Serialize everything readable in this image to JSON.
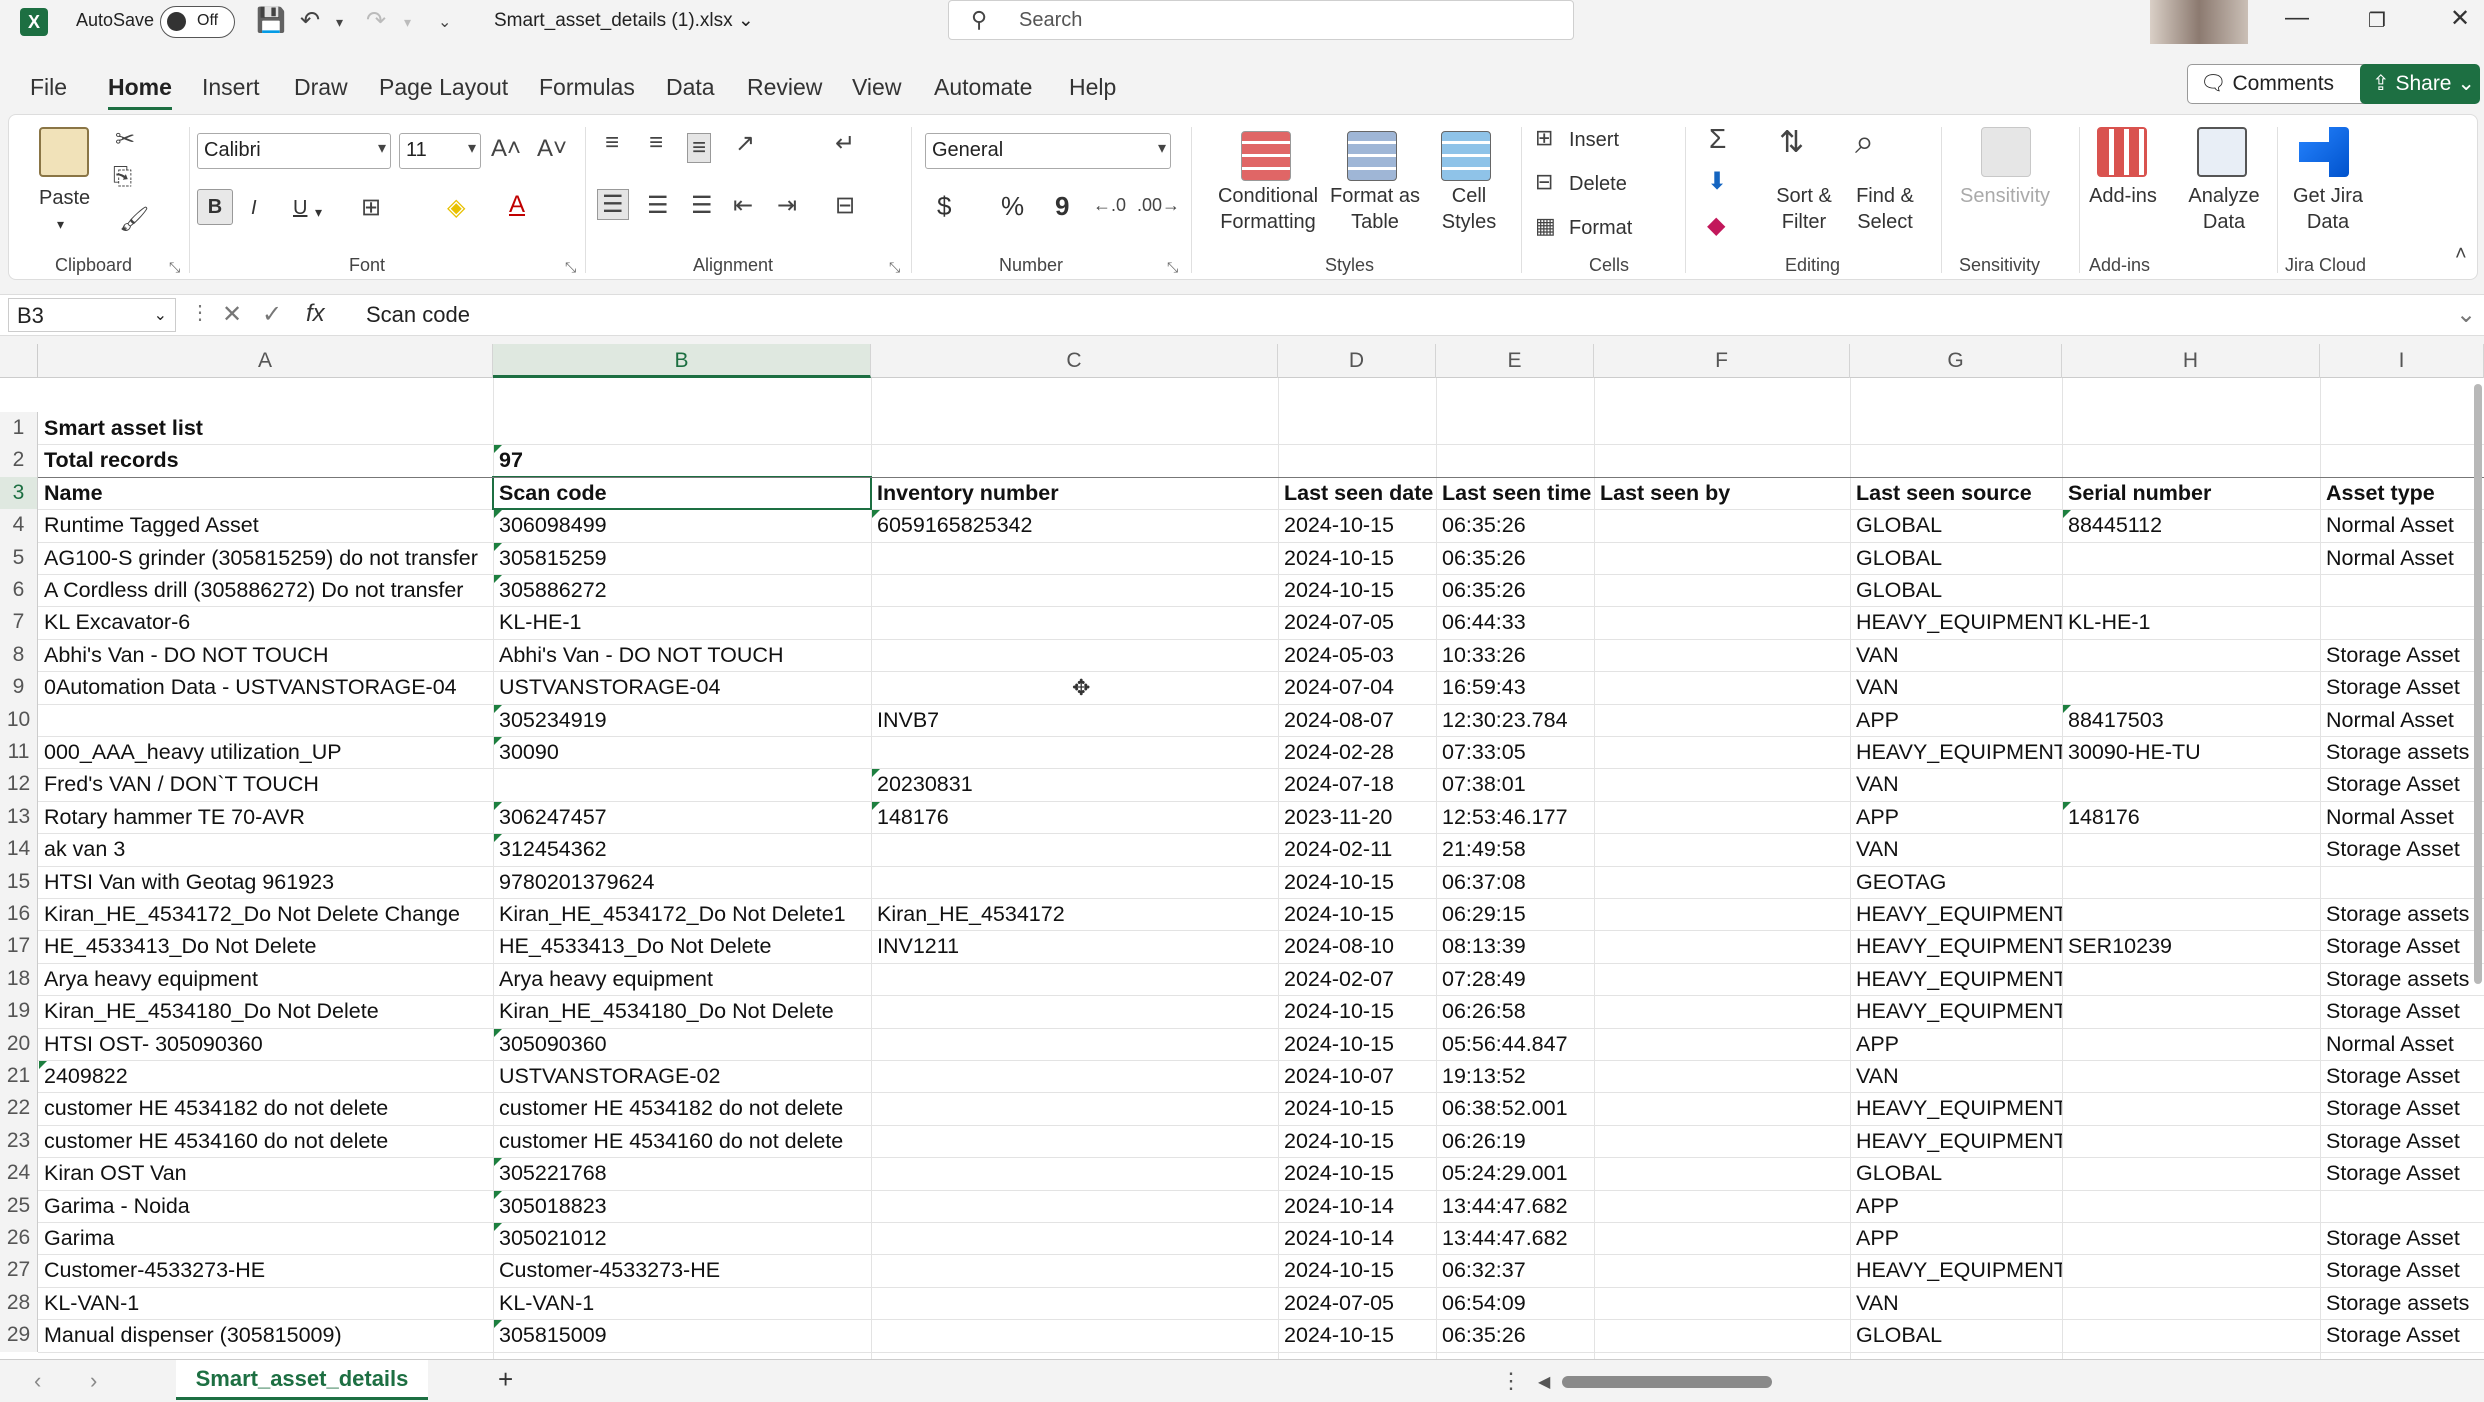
{
  "titlebar": {
    "autosave_label": "AutoSave",
    "autosave_state": "Off",
    "file_name": "Smart_asset_details (1).xlsx",
    "search_placeholder": "Search"
  },
  "menu_tabs": [
    "File",
    "Home",
    "Insert",
    "Draw",
    "Page Layout",
    "Formulas",
    "Data",
    "Review",
    "View",
    "Automate",
    "Help"
  ],
  "active_tab": "Home",
  "header_buttons": {
    "comments": "Comments",
    "share": "Share"
  },
  "ribbon": {
    "clipboard": {
      "paste": "Paste",
      "group": "Clipboard"
    },
    "font": {
      "name": "Calibri",
      "size": "11",
      "group": "Font",
      "bold": "B",
      "italic": "I",
      "underline": "U"
    },
    "alignment": {
      "group": "Alignment"
    },
    "number": {
      "format": "General",
      "group": "Number",
      "currency": "$",
      "percent": "%",
      "comma": "9"
    },
    "styles": {
      "conditional": "Conditional Formatting",
      "format_table": "Format as Table",
      "cell_styles": "Cell Styles",
      "group": "Styles"
    },
    "cells": {
      "insert": "Insert",
      "delete": "Delete",
      "format": "Format",
      "group": "Cells"
    },
    "editing": {
      "sort_filter": "Sort & Filter",
      "find_select": "Find & Select",
      "group": "Editing"
    },
    "sensitivity": {
      "label": "Sensitivity",
      "group": "Sensitivity"
    },
    "addins": {
      "label": "Add-ins",
      "group": "Add-ins",
      "analyze": "Analyze Data"
    },
    "jira": {
      "label": "Get Jira Data",
      "group": "Jira Cloud"
    }
  },
  "formula_bar": {
    "name_box": "B3",
    "fx": "fx",
    "content": "Scan code"
  },
  "columns": [
    "A",
    "B",
    "C",
    "D",
    "E",
    "F",
    "G",
    "H",
    "I"
  ],
  "selected_column": "B",
  "selected_row": "3",
  "rows": [
    {
      "n": "1",
      "cells": [
        "Smart asset list",
        "",
        "",
        "",
        "",
        "",
        "",
        "",
        ""
      ]
    },
    {
      "n": "2",
      "cells": [
        "Total records",
        "97",
        "",
        "",
        "",
        "",
        "",
        "",
        ""
      ]
    },
    {
      "n": "3",
      "cells": [
        "Name",
        "Scan code",
        "Inventory number",
        "Last seen date",
        "Last seen time",
        "Last seen by",
        "Last seen source",
        "Serial number",
        "Asset type"
      ]
    },
    {
      "n": "4",
      "cells": [
        "Runtime Tagged Asset",
        "306098499",
        "6059165825342",
        "2024-10-15",
        "06:35:26",
        "",
        "GLOBAL",
        "88445112",
        "Normal Asset"
      ]
    },
    {
      "n": "5",
      "cells": [
        "AG100-S grinder (305815259) do not transfer",
        "305815259",
        "",
        "2024-10-15",
        "06:35:26",
        "",
        "GLOBAL",
        "",
        "Normal Asset"
      ]
    },
    {
      "n": "6",
      "cells": [
        "A Cordless drill (305886272) Do not transfer",
        "305886272",
        "",
        "2024-10-15",
        "06:35:26",
        "",
        "GLOBAL",
        "",
        ""
      ]
    },
    {
      "n": "7",
      "cells": [
        "KL Excavator-6",
        "KL-HE-1",
        "",
        "2024-07-05",
        "06:44:33",
        "",
        "HEAVY_EQUIPMENT",
        "KL-HE-1",
        ""
      ]
    },
    {
      "n": "8",
      "cells": [
        "Abhi's Van - DO NOT TOUCH",
        "Abhi's Van - DO NOT TOUCH",
        "",
        "2024-05-03",
        "10:33:26",
        "",
        "VAN",
        "",
        "Storage Asset"
      ]
    },
    {
      "n": "9",
      "cells": [
        "0Automation Data - USTVANSTORAGE-04",
        "USTVANSTORAGE-04",
        "",
        "2024-07-04",
        "16:59:43",
        "",
        "VAN",
        "",
        "Storage Asset"
      ]
    },
    {
      "n": "10",
      "cells": [
        "",
        "305234919",
        "INVB7",
        "2024-08-07",
        "12:30:23.784",
        "",
        "APP",
        "88417503",
        "Normal Asset"
      ]
    },
    {
      "n": "11",
      "cells": [
        "000_AAA_heavy utilization_UP",
        "30090",
        "",
        "2024-02-28",
        "07:33:05",
        "",
        "HEAVY_EQUIPMENT",
        "30090-HE-TU",
        "Storage assets"
      ]
    },
    {
      "n": "12",
      "cells": [
        "Fred's VAN / DON`T TOUCH",
        "",
        "20230831",
        "2024-07-18",
        "07:38:01",
        "",
        "VAN",
        "",
        "Storage Asset"
      ]
    },
    {
      "n": "13",
      "cells": [
        "Rotary hammer TE 70-AVR",
        "306247457",
        "148176",
        "2023-11-20",
        "12:53:46.177",
        "",
        "APP",
        "148176",
        "Normal Asset"
      ]
    },
    {
      "n": "14",
      "cells": [
        "ak van 3",
        "312454362",
        "",
        "2024-02-11",
        "21:49:58",
        "",
        "VAN",
        "",
        "Storage Asset"
      ]
    },
    {
      "n": "15",
      "cells": [
        "HTSI Van with Geotag 961923",
        "9780201379624",
        "",
        "2024-10-15",
        "06:37:08",
        "",
        "GEOTAG",
        "",
        ""
      ]
    },
    {
      "n": "16",
      "cells": [
        "Kiran_HE_4534172_Do Not Delete Change",
        "Kiran_HE_4534172_Do Not Delete1",
        "Kiran_HE_4534172",
        "2024-10-15",
        "06:29:15",
        "",
        "HEAVY_EQUIPMENT",
        "",
        "Storage assets"
      ]
    },
    {
      "n": "17",
      "cells": [
        "HE_4533413_Do Not Delete",
        "HE_4533413_Do Not Delete",
        "INV1211",
        "2024-08-10",
        "08:13:39",
        "",
        "HEAVY_EQUIPMENT",
        "SER10239",
        "Storage Asset"
      ]
    },
    {
      "n": "18",
      "cells": [
        "Arya heavy equipment",
        "Arya heavy equipment",
        "",
        "2024-02-07",
        "07:28:49",
        "",
        "HEAVY_EQUIPMENT",
        "",
        "Storage assets"
      ]
    },
    {
      "n": "19",
      "cells": [
        "Kiran_HE_4534180_Do Not Delete",
        "Kiran_HE_4534180_Do Not Delete",
        "",
        "2024-10-15",
        "06:26:58",
        "",
        "HEAVY_EQUIPMENT",
        "",
        "Storage Asset"
      ]
    },
    {
      "n": "20",
      "cells": [
        "HTSI OST- 305090360",
        "305090360",
        "",
        "2024-10-15",
        "05:56:44.847",
        "",
        "APP",
        "",
        "Normal Asset"
      ]
    },
    {
      "n": "21",
      "cells": [
        "2409822",
        "USTVANSTORAGE-02",
        "",
        "2024-10-07",
        "19:13:52",
        "",
        "VAN",
        "",
        "Storage Asset"
      ]
    },
    {
      "n": "22",
      "cells": [
        "customer HE 4534182 do not delete",
        "customer HE 4534182 do not delete",
        "",
        "2024-10-15",
        "06:38:52.001",
        "",
        "HEAVY_EQUIPMENT",
        "",
        "Storage Asset"
      ]
    },
    {
      "n": "23",
      "cells": [
        "customer HE 4534160 do not delete",
        "customer HE 4534160 do not delete",
        "",
        "2024-10-15",
        "06:26:19",
        "",
        "HEAVY_EQUIPMENT",
        "",
        "Storage Asset"
      ]
    },
    {
      "n": "24",
      "cells": [
        "Kiran OST Van",
        "305221768",
        "",
        "2024-10-15",
        "05:24:29.001",
        "",
        "GLOBAL",
        "",
        "Storage Asset"
      ]
    },
    {
      "n": "25",
      "cells": [
        "Garima - Noida",
        "305018823",
        "",
        "2024-10-14",
        "13:44:47.682",
        "",
        "APP",
        "",
        ""
      ]
    },
    {
      "n": "26",
      "cells": [
        "Garima",
        "305021012",
        "",
        "2024-10-14",
        "13:44:47.682",
        "",
        "APP",
        "",
        "Storage Asset"
      ]
    },
    {
      "n": "27",
      "cells": [
        "Customer-4533273-HE",
        "Customer-4533273-HE",
        "",
        "2024-10-15",
        "06:32:37",
        "",
        "HEAVY_EQUIPMENT",
        "",
        "Storage Asset"
      ]
    },
    {
      "n": "28",
      "cells": [
        "KL-VAN-1",
        "KL-VAN-1",
        "",
        "2024-07-05",
        "06:54:09",
        "",
        "VAN",
        "",
        "Storage assets"
      ]
    },
    {
      "n": "29",
      "cells": [
        "Manual dispenser (305815009)",
        "305815009",
        "",
        "2024-10-15",
        "06:35:26",
        "",
        "GLOBAL",
        "",
        "Storage Asset"
      ]
    }
  ],
  "sheet_tabs": [
    "Smart_asset_details"
  ],
  "add_sheet": "+"
}
